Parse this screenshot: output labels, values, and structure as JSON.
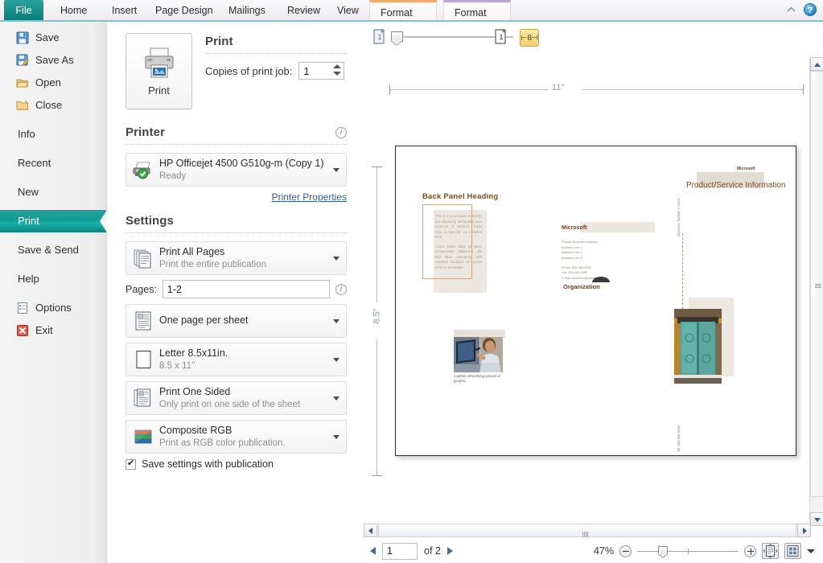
{
  "ribbon": {
    "tabs": [
      {
        "label": "File",
        "kind": "file"
      },
      {
        "label": "Home",
        "kind": "normal"
      },
      {
        "label": "Insert",
        "kind": "normal"
      },
      {
        "label": "Page Design",
        "kind": "normal"
      },
      {
        "label": "Mailings",
        "kind": "normal"
      },
      {
        "label": "Review",
        "kind": "normal"
      },
      {
        "label": "View",
        "kind": "normal"
      },
      {
        "label": "Format",
        "kind": "contextual-orange"
      },
      {
        "label": "Format",
        "kind": "contextual-purple"
      }
    ],
    "minimize_icon": "chevron-up-icon",
    "help_icon": "help-question-icon",
    "help_label": "?"
  },
  "sidebar": {
    "items": [
      {
        "label": "Save",
        "icon": "save-disk-icon",
        "active": false
      },
      {
        "label": "Save As",
        "icon": "save-as-disk-icon",
        "active": false
      },
      {
        "label": "Open",
        "icon": "open-folder-icon",
        "active": false
      },
      {
        "label": "Close",
        "icon": "close-folder-icon",
        "active": false
      },
      {
        "label": "Info",
        "icon": null,
        "active": false
      },
      {
        "label": "Recent",
        "icon": null,
        "active": false
      },
      {
        "label": "New",
        "icon": null,
        "active": false
      },
      {
        "label": "Print",
        "icon": null,
        "active": true
      },
      {
        "label": "Save & Send",
        "icon": null,
        "active": false
      },
      {
        "label": "Help",
        "icon": null,
        "active": false
      },
      {
        "label": "Options",
        "icon": "options-icon",
        "active": false
      },
      {
        "label": "Exit",
        "icon": "exit-icon",
        "active": false
      }
    ]
  },
  "print_pane": {
    "heading": "Print",
    "print_button_label": "Print",
    "print_button_icon": "printer-icon",
    "copies_label": "Copies of print job:",
    "copies_value": "1",
    "printer_heading": "Printer",
    "printer_info_icon": "info-icon",
    "printer_name": "HP Officejet 4500 G510g-m (Copy 1)",
    "printer_status": "Ready",
    "printer_properties_link": "Printer Properties",
    "settings_heading": "Settings",
    "options": [
      {
        "title": "Print All Pages",
        "subtitle": "Print the entire publication",
        "icon": "all-pages-icon"
      },
      {
        "title": "One page per sheet",
        "subtitle": "",
        "icon": "one-page-per-sheet-icon"
      },
      {
        "title": "Letter 8.5x11in.",
        "subtitle": "8.5 x 11\"",
        "icon": "paper-size-icon"
      },
      {
        "title": "Print One Sided",
        "subtitle": "Only print on one side of the sheet",
        "icon": "one-sided-icon"
      },
      {
        "title": "Composite RGB",
        "subtitle": "Print as RGB color publication.",
        "icon": "color-rgb-icon"
      }
    ],
    "pages_label": "Pages:",
    "pages_value": "1-2",
    "pages_info_icon": "info-icon",
    "save_settings_label": "Save settings with publication",
    "save_settings_checked": true
  },
  "preview": {
    "toolbar": {
      "front_page_icon": "single-page-view-icon",
      "back_page_icon": "single-page-sheet-icon",
      "ruler_toggle_icon": "measurement-ruler-icon",
      "ruler_toggle_label": "⊢8⊣"
    },
    "ruler_horizontal_label": "11\"",
    "ruler_vertical_label": "8.5\"",
    "page": {
      "back_panel_heading": "Back Panel Heading",
      "back_panel_paragraphs": [
        "This is a good place to briefly, but effectively, summarize your products or services. Sales copy is typically not included here.",
        "Lorem ipsum dolor sit amet, consectetuer adipiscing elit, sed diem nonummy nibh euismod tincidunt ut lacreet dolor et accumsan."
      ],
      "brand_top": "Microsoft",
      "product_service_title": "Product/Service Information",
      "vertical_tagline": "Business Tagline or Motto",
      "vertical_phone": "Tel: 555 555 5555",
      "picture_caption": "Caption describing picture or graphic.",
      "brand_mid": "Microsoft",
      "address_lines": [
        "Primary Business Address",
        "Address Line 2",
        "Address Line 3",
        "Address Line 4"
      ],
      "contact_lines": [
        "Phone: 555-555-5555",
        "Fax: 555-555-5555",
        "E-mail: someone@example.com"
      ],
      "organization_label": "Organization",
      "door_image_alt": "turquoise-door-photo",
      "person_image_alt": "woman-at-computer-photo"
    }
  },
  "statusbar": {
    "prev_icon": "previous-page-arrow",
    "next_icon": "next-page-arrow",
    "page_value": "1",
    "of_label": "of 2",
    "zoom_percent": "47%",
    "zoom_out_icon": "zoom-out-icon",
    "zoom_in_icon": "zoom-in-icon",
    "fit_page_icon": "fit-page-icon",
    "multi_page_icon": "multiple-pages-icon",
    "multi_page_dropdown_icon": "chevron-down-icon"
  },
  "colors": {
    "accent_teal": "#17a59d",
    "contextual_orange": "#f6a96a",
    "contextual_purple": "#b9a7d8",
    "brand_brown": "#7a4a24",
    "door_teal": "#55a09a"
  }
}
